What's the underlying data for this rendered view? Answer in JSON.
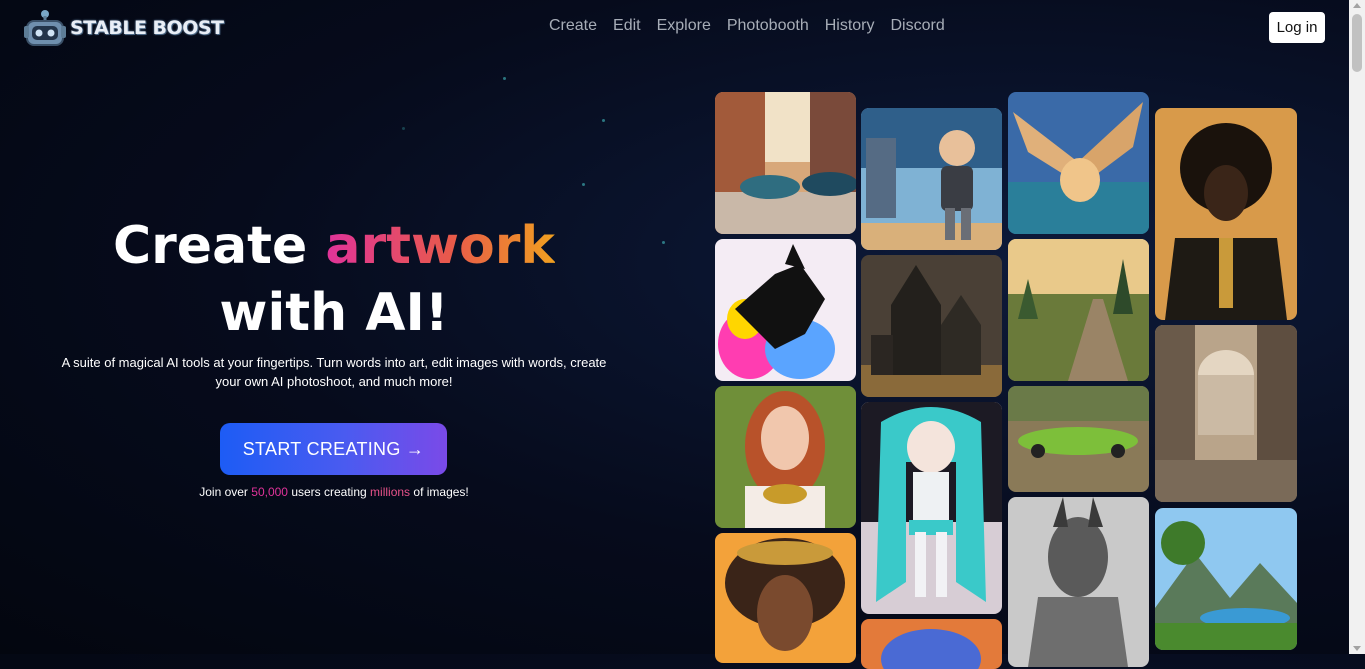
{
  "brand": {
    "name": "STABLE BOOST"
  },
  "nav": {
    "items": [
      "Create",
      "Edit",
      "Explore",
      "Photobooth",
      "History",
      "Discord"
    ],
    "login_label": "Log in"
  },
  "hero": {
    "title_part1": "Create",
    "title_accent": "artwork",
    "title_part2": "with AI!",
    "subtitle": "A suite of magical AI tools at your fingertips. Turn words into art, edit images with words, create your own AI photoshoot, and much more!",
    "cta_label": "START CREATING →",
    "join_prefix": "Join over",
    "join_users": "50,000",
    "join_mid": "users creating",
    "join_millions": "millions",
    "join_suffix": "of images!"
  },
  "colors": {
    "accent_start": "#e0339a",
    "accent_end": "#f0a020",
    "cta_start": "#1d5cf5",
    "cta_end": "#7a4ae8"
  },
  "gallery": {
    "images": [
      "painted-street-cars",
      "cartoon-robot-boy",
      "winged-dog",
      "portrait-afro-man",
      "neon-black-dog",
      "gothic-castle",
      "forest-road",
      "domed-city-ruins",
      "redhead-woman",
      "anime-girl-teal-hair",
      "green-vintage-car",
      "armored-warrior-sketch",
      "mountain-lake-landscape",
      "tribal-queen-portrait",
      "fox-fur"
    ]
  }
}
